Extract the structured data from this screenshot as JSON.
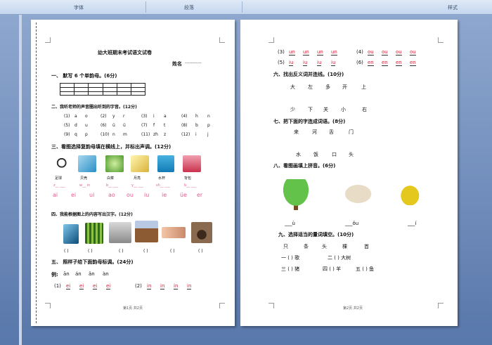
{
  "ribbon": {
    "groups": [
      "字体",
      "段落",
      "样式"
    ]
  },
  "page1": {
    "title": "幼大班期末考试语文试卷",
    "name_label": "姓名",
    "name_line": "-----------",
    "q1": "一、 默写 6 个单韵母。(6分)",
    "q2": "二、我听老师的声音圈出听到的字音。(12分)",
    "q2_rows": [
      [
        "(1)",
        "a",
        "o",
        "(2)",
        "y",
        "r",
        "(3)",
        "i",
        "a",
        "(4)",
        "h",
        "n"
      ],
      [
        "(5)",
        "d",
        "u",
        "(6)",
        "ü",
        "ü",
        "(7)",
        "f",
        "t",
        "(8)",
        "b",
        "p"
      ],
      [
        "(9)",
        "q",
        "p",
        "(10)",
        "n",
        "m",
        "(11)",
        "zh",
        "z",
        "(12)",
        "i",
        "j"
      ]
    ],
    "q3": "三、看图选择复韵母填在横线上，并标出声调。(12分)",
    "q3_captions": [
      "足球",
      "贝壳",
      "白菜",
      "月亮",
      "水杯",
      "背包"
    ],
    "q3_blanks": [
      "z__ ___",
      "w__ in",
      "b__ ___",
      "y__ ___",
      "sh__ ___",
      "b__ ___"
    ],
    "q3_options": [
      "ai",
      "ei",
      "ui",
      "ao",
      "ou",
      "iu",
      "ie",
      "üe",
      "er"
    ],
    "q4": "四、我能根据图上的内容写出汉字。(12分)",
    "q4_parens": [
      "( )",
      "( )",
      "( )",
      "( )",
      "( )",
      "( )"
    ],
    "q5": "五、 照样子给下面韵母标调。(24分)",
    "q5_example_label": "例:",
    "q5_example": [
      "ān",
      "án",
      "ǎn",
      "àn"
    ],
    "q5_items": [
      {
        "num": "(1)",
        "syllables": [
          "ei",
          "ei",
          "ei",
          "ei"
        ]
      },
      {
        "num": "(2)",
        "syllables": [
          "in",
          "in",
          "in",
          "in"
        ]
      }
    ],
    "footer": "第1页 共2页"
  },
  "page2": {
    "q5_rows": [
      {
        "num": "(3)",
        "syllables": [
          "un",
          "un",
          "un",
          "un"
        ]
      },
      {
        "num": "(4)",
        "syllables": [
          "ou",
          "ou",
          "ou",
          "ou"
        ]
      },
      {
        "num": "(5)",
        "syllables": [
          "iu",
          "iu",
          "iu",
          "iu"
        ]
      },
      {
        "num": "(6)",
        "syllables": [
          "en",
          "en",
          "en",
          "en"
        ]
      }
    ],
    "q6": "六、找出反义词并连线。(10分)",
    "q6_top": [
      "大",
      "左",
      "多",
      "开",
      "上"
    ],
    "q6_bottom": [
      "少",
      "下",
      "关",
      "小",
      "右"
    ],
    "q7": "七、把下面的字连成词语。(8分)",
    "q7_top": [
      "来",
      "河",
      "舌",
      "门"
    ],
    "q7_bottom": [
      "水",
      "饭",
      "口",
      "头"
    ],
    "q8": "八、看图画填上拼音。(6分)",
    "q8_blanks": [
      "___ù",
      "___ǒu",
      "___í"
    ],
    "q9": "九、选择适当的量词填空。(10分)",
    "q9_words": [
      "只",
      "条",
      "头",
      "棵",
      "首"
    ],
    "q9_lines": [
      [
        "一 (  ) 歌",
        "二 (  ) 大树"
      ],
      [
        "三 (  ) 猪",
        "四 (  ) 羊",
        "五 (  ) 鱼"
      ]
    ],
    "footer": "第2页 共2页"
  }
}
